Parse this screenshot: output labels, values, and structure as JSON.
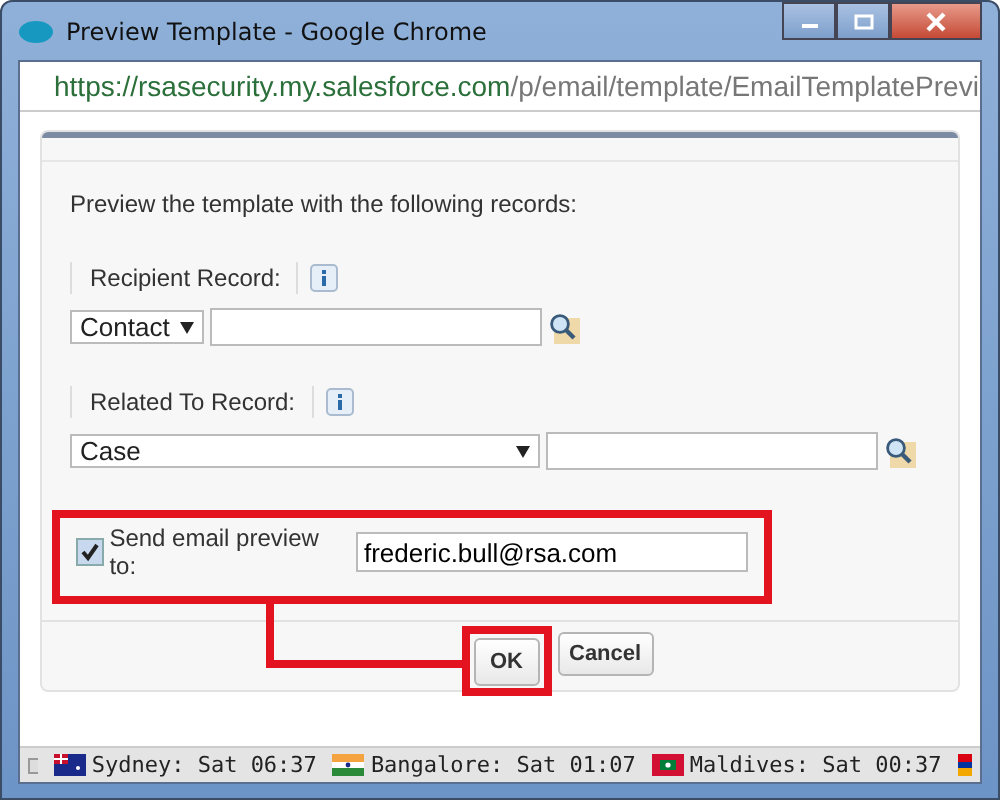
{
  "window": {
    "title": "Preview Template - Google Chrome"
  },
  "address_bar": {
    "host": "https://rsasecurity.my.salesforce.com",
    "path": "/p/email/template/EmailTemplatePrevi"
  },
  "form": {
    "intro": "Preview the template with the following records:",
    "recipient": {
      "label": "Recipient Record:",
      "select": "Contact"
    },
    "related": {
      "label": "Related To Record:",
      "select": "Case"
    },
    "send_preview": {
      "checked": true,
      "label": "Send email preview to:",
      "value": "frederic.bull@rsa.com"
    },
    "buttons": [
      "OK",
      "Cancel"
    ]
  },
  "status_bar": {
    "clocks": [
      {
        "kind": "au",
        "text": "Sydney: Sat 06:37"
      },
      {
        "kind": "in",
        "text": "Bangalore: Sat 01:07"
      },
      {
        "kind": "mv",
        "text": "Maldives: Sat 00:37"
      }
    ]
  }
}
